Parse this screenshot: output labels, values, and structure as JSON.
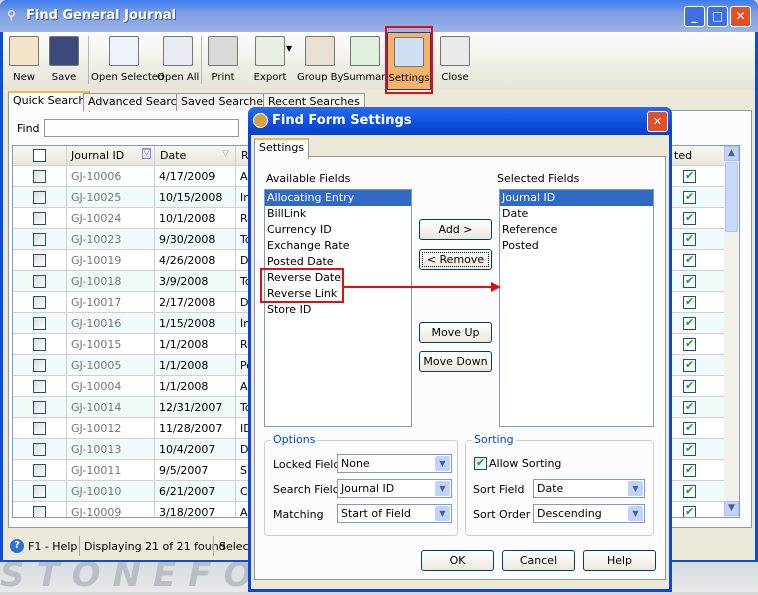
{
  "window": {
    "title": "Find General Journal",
    "min": "_",
    "max": "□",
    "close": "✕"
  },
  "toolbar": [
    {
      "label": "New",
      "icon": "new-icon"
    },
    {
      "label": "Save",
      "icon": "save-icon"
    },
    {
      "label": "Open Selected",
      "icon": "open-selected-icon"
    },
    {
      "label": "Open All",
      "icon": "open-all-icon"
    },
    {
      "label": "Print",
      "icon": "print-icon"
    },
    {
      "label": "Export",
      "icon": "export-icon"
    },
    {
      "label": "Group By",
      "icon": "group-by-icon"
    },
    {
      "label": "Summary",
      "icon": "summary-icon"
    },
    {
      "label": "Settings",
      "icon": "settings-icon"
    },
    {
      "label": "Close",
      "icon": "close-icon"
    }
  ],
  "tabs": [
    "Quick Search",
    "Advanced Search",
    "Saved Searches",
    "Recent Searches"
  ],
  "find": {
    "label": "Find",
    "value": ""
  },
  "grid": {
    "headers": [
      "Journal ID",
      "Date",
      "R",
      "ted"
    ],
    "rows": [
      [
        "GJ-10006",
        "4/17/2009",
        "As"
      ],
      [
        "GJ-10025",
        "10/15/2008",
        "In"
      ],
      [
        "GJ-10024",
        "10/1/2008",
        "Re"
      ],
      [
        "GJ-10023",
        "9/30/2008",
        "To"
      ],
      [
        "GJ-10019",
        "4/26/2008",
        "Di"
      ],
      [
        "GJ-10018",
        "3/9/2008",
        "To"
      ],
      [
        "GJ-10017",
        "2/17/2008",
        "De"
      ],
      [
        "GJ-10016",
        "1/15/2008",
        "In"
      ],
      [
        "GJ-10015",
        "1/1/2008",
        "Re"
      ],
      [
        "GJ-10005",
        "1/1/2008",
        "Po"
      ],
      [
        "GJ-10004",
        "1/1/2008",
        "Ai"
      ],
      [
        "GJ-10014",
        "12/31/2007",
        "To"
      ],
      [
        "GJ-10012",
        "11/28/2007",
        "ID"
      ],
      [
        "GJ-10013",
        "10/4/2007",
        "Di"
      ],
      [
        "GJ-10011",
        "9/5/2007",
        "Sm"
      ],
      [
        "GJ-10010",
        "6/21/2007",
        "Co"
      ],
      [
        "GJ-10009",
        "3/18/2007",
        "Ac"
      ]
    ]
  },
  "status": {
    "help": "F1 - Help",
    "count": "Displaying 21 of 21 found",
    "extra": "Select"
  },
  "watermark": "STONEFORGE",
  "dialog": {
    "title": "Find Form Settings",
    "tab": "Settings",
    "available_label": "Available Fields",
    "selected_label": "Selected Fields",
    "available": [
      "Allocating Entry",
      "BillLink",
      "Currency ID",
      "Exchange Rate",
      "Posted Date",
      "Reverse Date",
      "Reverse Link",
      "Store ID"
    ],
    "selected": [
      "Journal ID",
      "Date",
      "Reference",
      "Posted"
    ],
    "add": "Add >",
    "remove": "< Remove",
    "move_up": "Move Up",
    "move_down": "Move Down",
    "options": {
      "title": "Options",
      "locked_label": "Locked Field",
      "locked": "None",
      "search_label": "Search Field",
      "search": "Journal ID",
      "matching_label": "Matching",
      "matching": "Start of Field"
    },
    "sorting": {
      "title": "Sorting",
      "allow": "Allow Sorting",
      "allow_checked": true,
      "field_label": "Sort Field",
      "field": "Date",
      "order_label": "Sort Order",
      "order": "Descending"
    },
    "ok": "OK",
    "cancel": "Cancel",
    "help": "Help"
  },
  "colors": {
    "accent": "#0a4ed6",
    "highlight": "#e01010",
    "selection": "#316ac5"
  }
}
